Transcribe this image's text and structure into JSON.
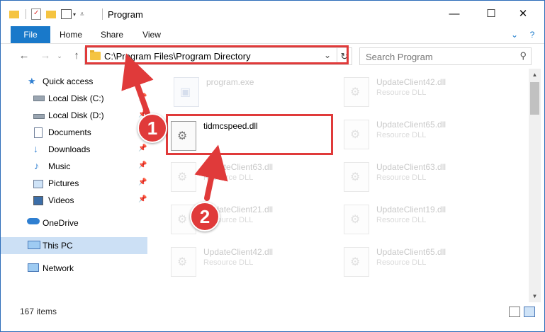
{
  "window": {
    "title": "Program",
    "minimize": "—",
    "maximize": "☐",
    "close": "✕"
  },
  "ribbon": {
    "tabs": [
      {
        "label": "File"
      },
      {
        "label": "Home"
      },
      {
        "label": "Share"
      },
      {
        "label": "View"
      }
    ],
    "help": "?"
  },
  "address_bar": {
    "back": "←",
    "forward": "→",
    "up": "↑",
    "path": "C:\\Program Files\\Program Directory",
    "refresh": "↻",
    "search_placeholder": "Search Program"
  },
  "nav_pane": {
    "quick_access": "Quick access",
    "items": [
      {
        "label": "Local Disk (C:)",
        "icon": "drive-icon"
      },
      {
        "label": "Local Disk (D:)",
        "icon": "drive-icon"
      },
      {
        "label": "Documents",
        "icon": "documents-icon"
      },
      {
        "label": "Downloads",
        "icon": "downloads-icon"
      },
      {
        "label": "Music",
        "icon": "music-icon"
      },
      {
        "label": "Pictures",
        "icon": "pictures-icon"
      },
      {
        "label": "Videos",
        "icon": "videos-icon"
      }
    ],
    "onedrive": "OneDrive",
    "this_pc": "This PC",
    "network": "Network"
  },
  "files": {
    "left": [
      {
        "name": "program.exe",
        "type": ""
      },
      {
        "name": "tidmcspeed.dll",
        "type": ""
      },
      {
        "name": "UpdateClient63.dll",
        "type": "Resource DLL"
      },
      {
        "name": "UpdateClient21.dll",
        "type": "Resource DLL"
      },
      {
        "name": "UpdateClient42.dll",
        "type": "Resource DLL"
      }
    ],
    "right": [
      {
        "name": "UpdateClient42.dll",
        "type": "Resource DLL"
      },
      {
        "name": "UpdateClient65.dll",
        "type": "Resource DLL"
      },
      {
        "name": "UpdateClient63.dll",
        "type": "Resource DLL"
      },
      {
        "name": "UpdateClient19.dll",
        "type": "Resource DLL"
      },
      {
        "name": "UpdateClient65.dll",
        "type": "Resource DLL"
      }
    ]
  },
  "status": {
    "item_count": "167 items"
  },
  "annotations": {
    "step1": "1",
    "step2": "2",
    "color": "#e03a3a"
  }
}
